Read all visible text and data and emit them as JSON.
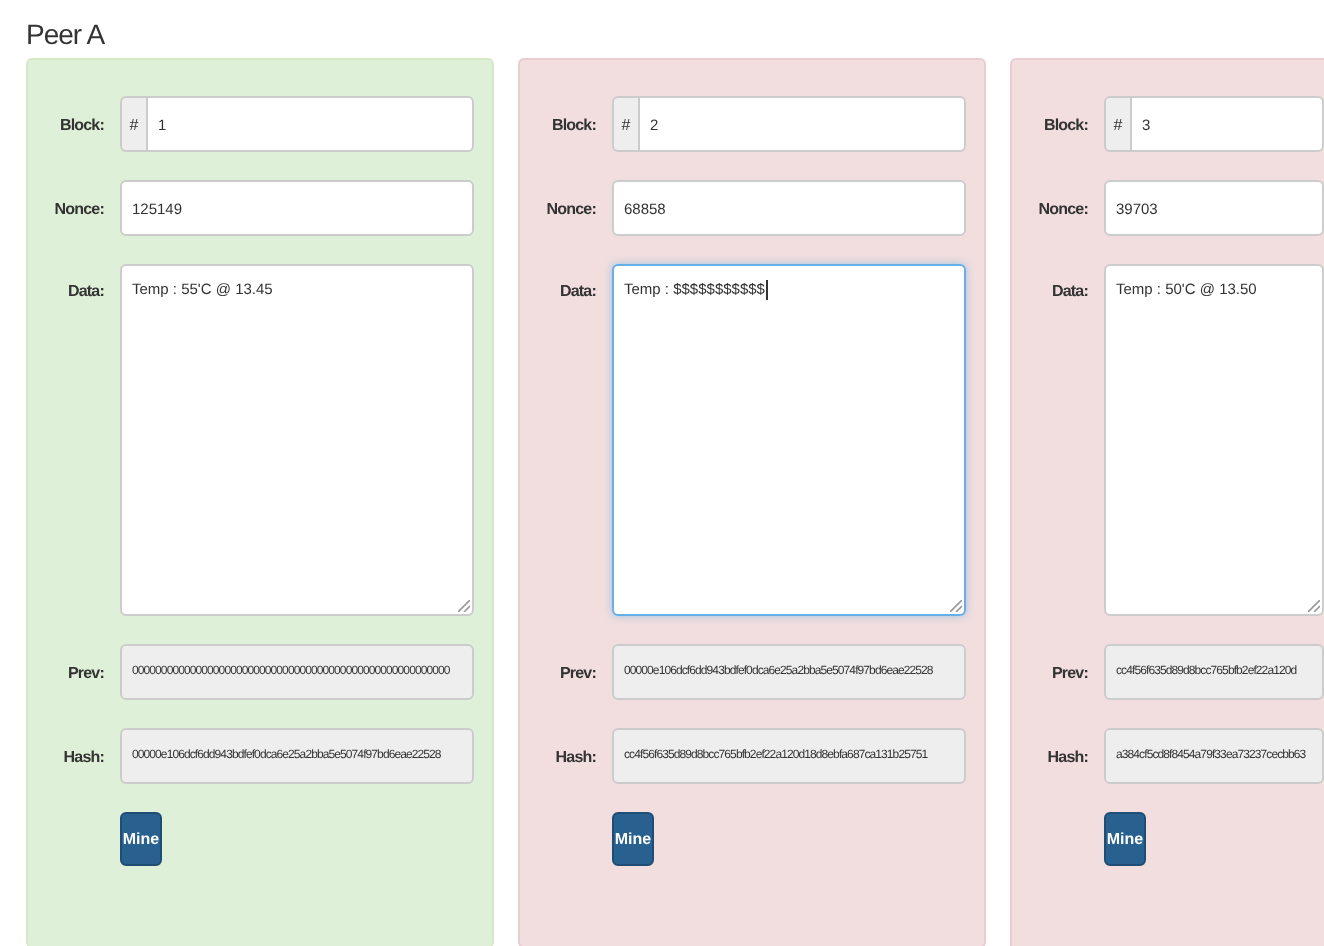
{
  "title": "Peer A",
  "blocks": [
    {
      "valid": true,
      "block_label": "Block:",
      "prefix": "#",
      "block": "1",
      "nonce_label": "Nonce:",
      "nonce": "125149",
      "data_label": "Data:",
      "data": "Temp : 55'C @ 13.45",
      "focused": false,
      "prev_label": "Prev:",
      "prev": "0000000000000000000000000000000000000000000000000000000",
      "hash_label": "Hash:",
      "hash": "00000e106dcf6dd943bdfef0dca6e25a2bba5e5074f97bd6eae22528",
      "button": "Mine"
    },
    {
      "valid": false,
      "block_label": "Block:",
      "prefix": "#",
      "block": "2",
      "nonce_label": "Nonce:",
      "nonce": "68858",
      "data_label": "Data:",
      "data": "Temp : $$$$$$$$$$$",
      "focused": true,
      "prev_label": "Prev:",
      "prev": "00000e106dcf6dd943bdfef0dca6e25a2bba5e5074f97bd6eae22528",
      "hash_label": "Hash:",
      "hash": "cc4f56f635d89d8bcc765bfb2ef22a120d18d8ebfa687ca131b25751",
      "button": "Mine"
    },
    {
      "valid": false,
      "block_label": "Block:",
      "prefix": "#",
      "block": "3",
      "nonce_label": "Nonce:",
      "nonce": "39703",
      "data_label": "Data:",
      "data": "Temp : 50'C @ 13.50",
      "focused": false,
      "prev_label": "Prev:",
      "prev": "cc4f56f635d89d8bcc765bfb2ef22a120d",
      "hash_label": "Hash:",
      "hash": "a384cf5cd8f8454a79f33ea73237cecbb63",
      "button": "Mine"
    }
  ]
}
